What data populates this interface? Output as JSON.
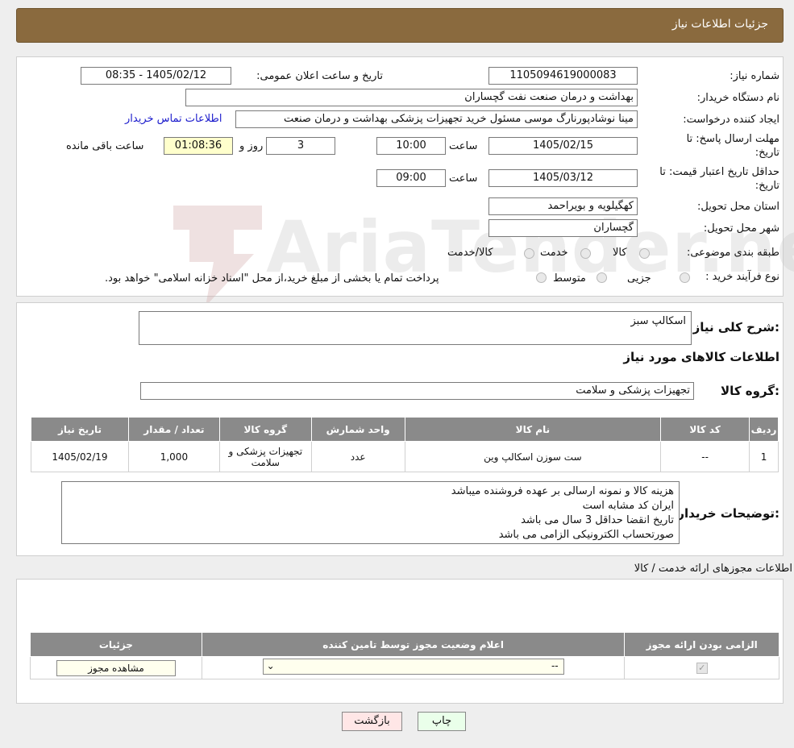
{
  "header": {
    "title": "جزئیات اطلاعات نیاز"
  },
  "form": {
    "need_number_label": "شماره نیاز:",
    "need_number": "1105094619000083",
    "announce_label": "تاریخ و ساعت اعلان عمومی:",
    "announce_value": "1405/02/12 - 08:35",
    "buyer_org_label": "نام دستگاه خریدار:",
    "buyer_org": "بهداشت و درمان صنعت نفت گچساران",
    "creator_label": "ایجاد کننده درخواست:",
    "creator": "مینا نوشادپورنارگ موسی مسئول خرید تجهیزات پزشکی  بهداشت و درمان صنعت",
    "contact_link": "اطلاعات تماس خریدار",
    "deadline_label_1": "مهلت ارسال پاسخ: تا",
    "deadline_label_2": "تاریخ:",
    "deadline_date": "1405/02/15",
    "time_label": "ساعت",
    "deadline_time": "10:00",
    "days": "3",
    "days_label": "روز و",
    "remaining": "01:08:36",
    "remaining_label": "ساعت باقی مانده",
    "validity_label_1": "حداقل تاریخ اعتبار قیمت: تا",
    "validity_label_2": "تاریخ:",
    "validity_date": "1405/03/12",
    "validity_time": "09:00",
    "province_label": "استان محل تحویل:",
    "province": "کهگیلویه و بویراحمد",
    "city_label": "شهر محل تحویل:",
    "city": "گچساران",
    "category_label": "طبقه بندی موضوعی:",
    "category_options": [
      "کالا",
      "خدمت",
      "کالا/خدمت"
    ],
    "process_label": "نوع فرآیند خرید :",
    "process_options": [
      "جزیی",
      "متوسط"
    ],
    "process_note": "پرداخت تمام یا بخشی از مبلغ خرید،از محل \"اسناد خزانه اسلامی\" خواهد بود."
  },
  "summary": {
    "desc_label": "شرح کلی نیاز:",
    "desc_value": "اسکالپ سبز",
    "goods_info_title": "اطلاعات کالاهای مورد نیاز",
    "group_label": "گروه کالا:",
    "group_value": "تجهیزات پزشکی و سلامت",
    "table": {
      "headers": [
        "ردیف",
        "کد کالا",
        "نام کالا",
        "واحد شمارش",
        "گروه کالا",
        "تعداد / مقدار",
        "تاریخ نیاز"
      ],
      "row": [
        "1",
        "--",
        "ست سوزن اسکالپ وین",
        "عدد",
        "تجهیزات پزشکی و سلامت",
        "1,000",
        "1405/02/19"
      ]
    },
    "buyer_notes_label": "توضیحات خریدار:",
    "buyer_notes": [
      "هزینه کالا و نمونه ارسالی بر عهده فروشنده میباشد",
      "ایران کد مشابه است",
      "تاریخ انقضا حداقل 3 سال می باشد",
      "صورتحساب الکترونیکی الزامی می باشد"
    ]
  },
  "permits": {
    "title": "اطلاعات مجوزهای ارائه خدمت / کالا",
    "headers": [
      "الزامی بودن ارائه مجوز",
      "اعلام وضعیت مجوز توسط تامین کننده",
      "جزئیات"
    ],
    "select_value": "--",
    "view_button": "مشاهده مجوز"
  },
  "footer": {
    "print": "چاپ",
    "back": "بازگشت"
  },
  "watermark": "AriaTender.neT"
}
